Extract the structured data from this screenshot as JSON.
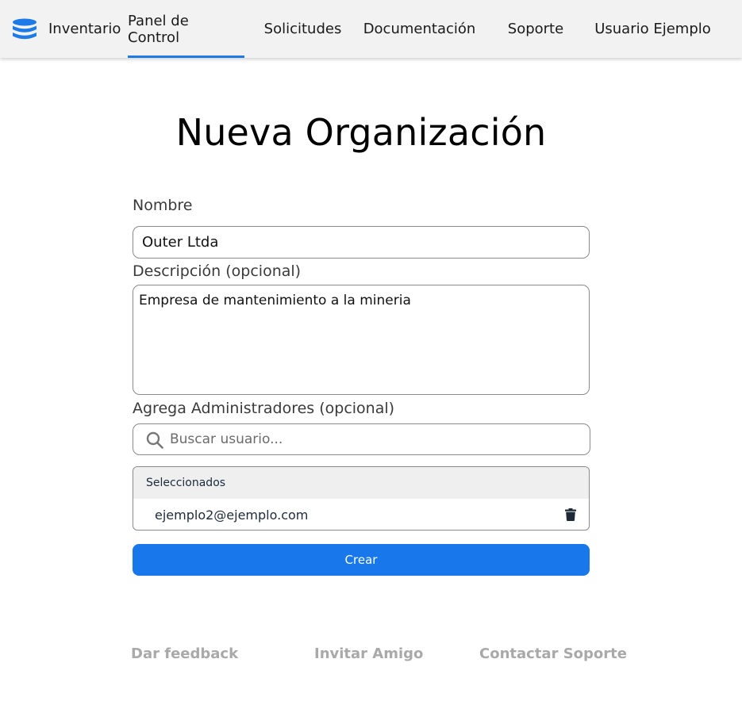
{
  "navbar": {
    "brand": "Inventario",
    "brand_icon": "database-icon",
    "brand_icon_color": "#1d7ae6",
    "items": [
      {
        "label": "Panel de Control",
        "active": true
      },
      {
        "label": "Solicitudes",
        "active": false
      },
      {
        "label": "Documentación",
        "active": false
      },
      {
        "label": "Soporte",
        "active": false
      },
      {
        "label": "Usuario Ejemplo",
        "active": false
      }
    ],
    "active_color": "#1d7ae6"
  },
  "page": {
    "title": "Nueva Organización"
  },
  "form": {
    "name_label": "Nombre",
    "name_value": "Outer Ltda",
    "description_label": "Descripción (opcional)",
    "description_value": "Empresa de mantenimiento a la mineria",
    "admins_label": "Agrega Administradores (opcional)",
    "search_placeholder": "Buscar usuario...",
    "search_icon": "search-icon",
    "selected_header": "Seleccionados",
    "selected_users": [
      {
        "email": "ejemplo2@ejemplo.com",
        "remove_icon": "trash-icon"
      }
    ],
    "submit_label": "Crear",
    "submit_color": "#1877ea"
  },
  "footer": {
    "links": [
      {
        "label": "Dar feedback"
      },
      {
        "label": "Invitar Amigo"
      },
      {
        "label": "Contactar Soporte"
      }
    ]
  }
}
